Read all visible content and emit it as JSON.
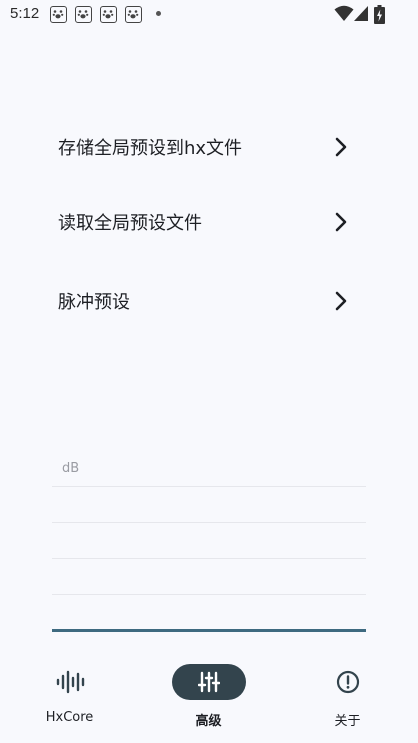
{
  "status_bar": {
    "time": "5:12",
    "notification_icons": [
      "paw-icon",
      "paw-icon",
      "paw-icon",
      "paw-icon"
    ],
    "system_icons": [
      "wifi-icon",
      "cell-signal-icon",
      "battery-charging-icon"
    ]
  },
  "menu": {
    "items": [
      {
        "label": "存储全局预设到hx文件",
        "icon": "chevron-right-icon"
      },
      {
        "label": "读取全局预设文件",
        "icon": "chevron-right-icon"
      },
      {
        "label": "脉冲预设",
        "icon": "chevron-right-icon"
      }
    ]
  },
  "eq": {
    "unit_label": "dB",
    "accent_color": "#3e6a80"
  },
  "bottom_nav": {
    "items": [
      {
        "label": "HxCore",
        "icon": "audio-waveform-icon",
        "active": false
      },
      {
        "label": "高级",
        "icon": "sliders-icon",
        "active": true
      },
      {
        "label": "关于",
        "icon": "info-circle-icon",
        "active": false
      }
    ],
    "active_color": "#33444d"
  }
}
